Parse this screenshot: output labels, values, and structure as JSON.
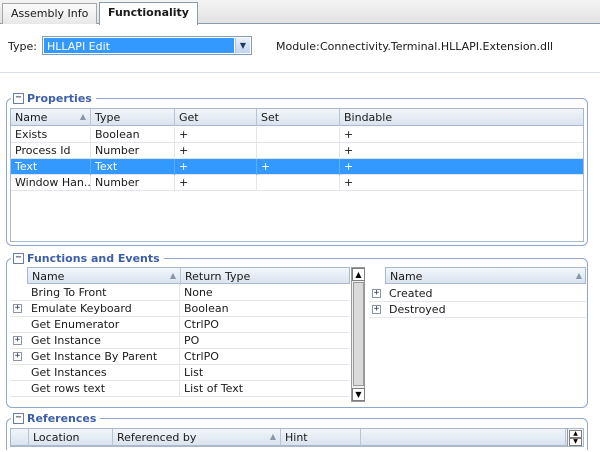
{
  "tabs": [
    {
      "label": "Assembly Info",
      "active": false
    },
    {
      "label": "Functionality",
      "active": true
    }
  ],
  "header": {
    "type_label": "Type:",
    "type_value": "HLLAPI Edit",
    "module_label": "Module:",
    "module_value": "Connectivity.Terminal.HLLAPI.Extension.dll"
  },
  "properties": {
    "title": "Properties",
    "columns": [
      "Name",
      "Type",
      "Get",
      "Set",
      "Bindable"
    ],
    "rows": [
      [
        "Exists",
        "Boolean",
        "+",
        "",
        "+"
      ],
      [
        "Process Id",
        "Number",
        "+",
        "",
        "+"
      ],
      [
        "Text",
        "Text",
        "+",
        "+",
        "+"
      ],
      [
        "Window Han...",
        "Number",
        "+",
        "",
        "+"
      ]
    ],
    "selected_row": 2
  },
  "functions": {
    "title": "Functions and Events",
    "columns": [
      "Name",
      "Return Type"
    ],
    "rows": [
      {
        "name": "Bring To Front",
        "ret": "None",
        "expandable": false
      },
      {
        "name": "Emulate Keyboard",
        "ret": "Boolean",
        "expandable": true
      },
      {
        "name": "Get Enumerator",
        "ret": "CtrlPO",
        "expandable": false
      },
      {
        "name": "Get Instance",
        "ret": "PO",
        "expandable": true
      },
      {
        "name": "Get Instance By Parent",
        "ret": "CtrlPO",
        "expandable": true
      },
      {
        "name": "Get Instances",
        "ret": "List",
        "expandable": false
      },
      {
        "name": "Get rows text",
        "ret": "List of Text",
        "expandable": false
      }
    ]
  },
  "events": {
    "columns": [
      "Name"
    ],
    "rows": [
      {
        "name": "Created",
        "expandable": true
      },
      {
        "name": "Destroyed",
        "expandable": true
      }
    ]
  },
  "references": {
    "title": "References",
    "columns": [
      "Location",
      "Referenced by",
      "Hint"
    ]
  },
  "icons": {
    "collapse": "−",
    "expand": "+",
    "sort": "▲",
    "dropdown": "▼",
    "scroll_up": "▲",
    "scroll_down": "▼"
  },
  "colors": {
    "selection": "#3399ff",
    "group_title": "#3d5fa8"
  }
}
